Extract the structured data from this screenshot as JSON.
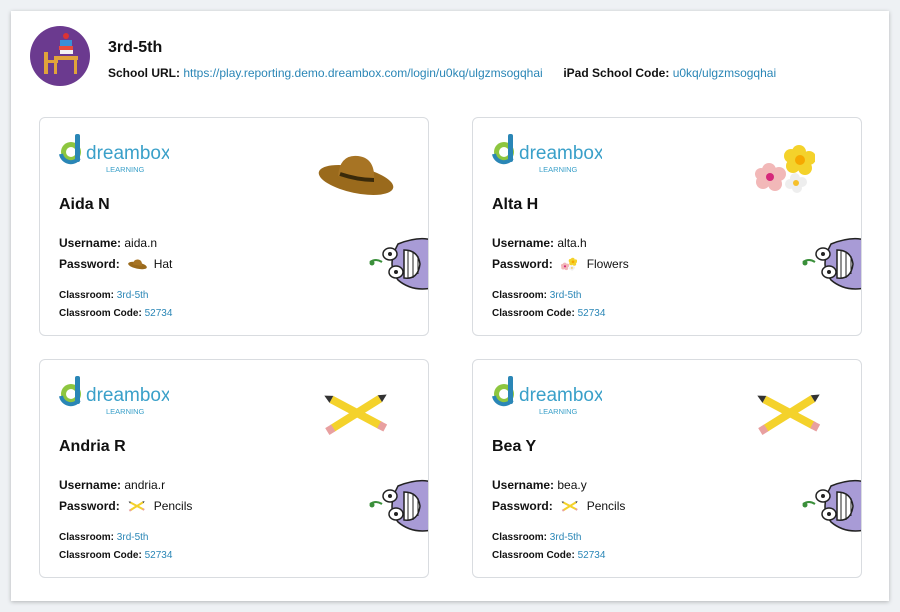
{
  "class": {
    "name": "3rd-5th",
    "school_url_label": "School URL:",
    "school_url": "https://play.reporting.demo.dreambox.com/login/u0kq/ulgzmsogqhai",
    "ipad_code_label": "iPad School Code:",
    "ipad_code": "u0kq/ulgzmsogqhai"
  },
  "labels": {
    "username": "Username:",
    "password": "Password:",
    "classroom": "Classroom:",
    "classroom_code": "Classroom Code:"
  },
  "logo": {
    "brand": "dreambox",
    "sub": "LEARNING",
    "brand_color": "#3aa0c9",
    "sub_color": "#3aa0c9"
  },
  "students": [
    {
      "name": "Aida N",
      "username": "aida.n",
      "password": "Hat",
      "picture": "hat-icon",
      "classroom": "3rd-5th",
      "classroom_code": "52734"
    },
    {
      "name": "Alta H",
      "username": "alta.h",
      "password": "Flowers",
      "picture": "flowers-icon",
      "classroom": "3rd-5th",
      "classroom_code": "52734"
    },
    {
      "name": "Andria R",
      "username": "andria.r",
      "password": "Pencils",
      "picture": "pencils-icon",
      "classroom": "3rd-5th",
      "classroom_code": "52734"
    },
    {
      "name": "Bea Y",
      "username": "bea.y",
      "password": "Pencils",
      "picture": "pencils-icon",
      "classroom": "3rd-5th",
      "classroom_code": "52734"
    }
  ],
  "colors": {
    "link": "#2a86b6",
    "avatar_bg": "#6b3a8f",
    "monster": "#a89bd6"
  }
}
